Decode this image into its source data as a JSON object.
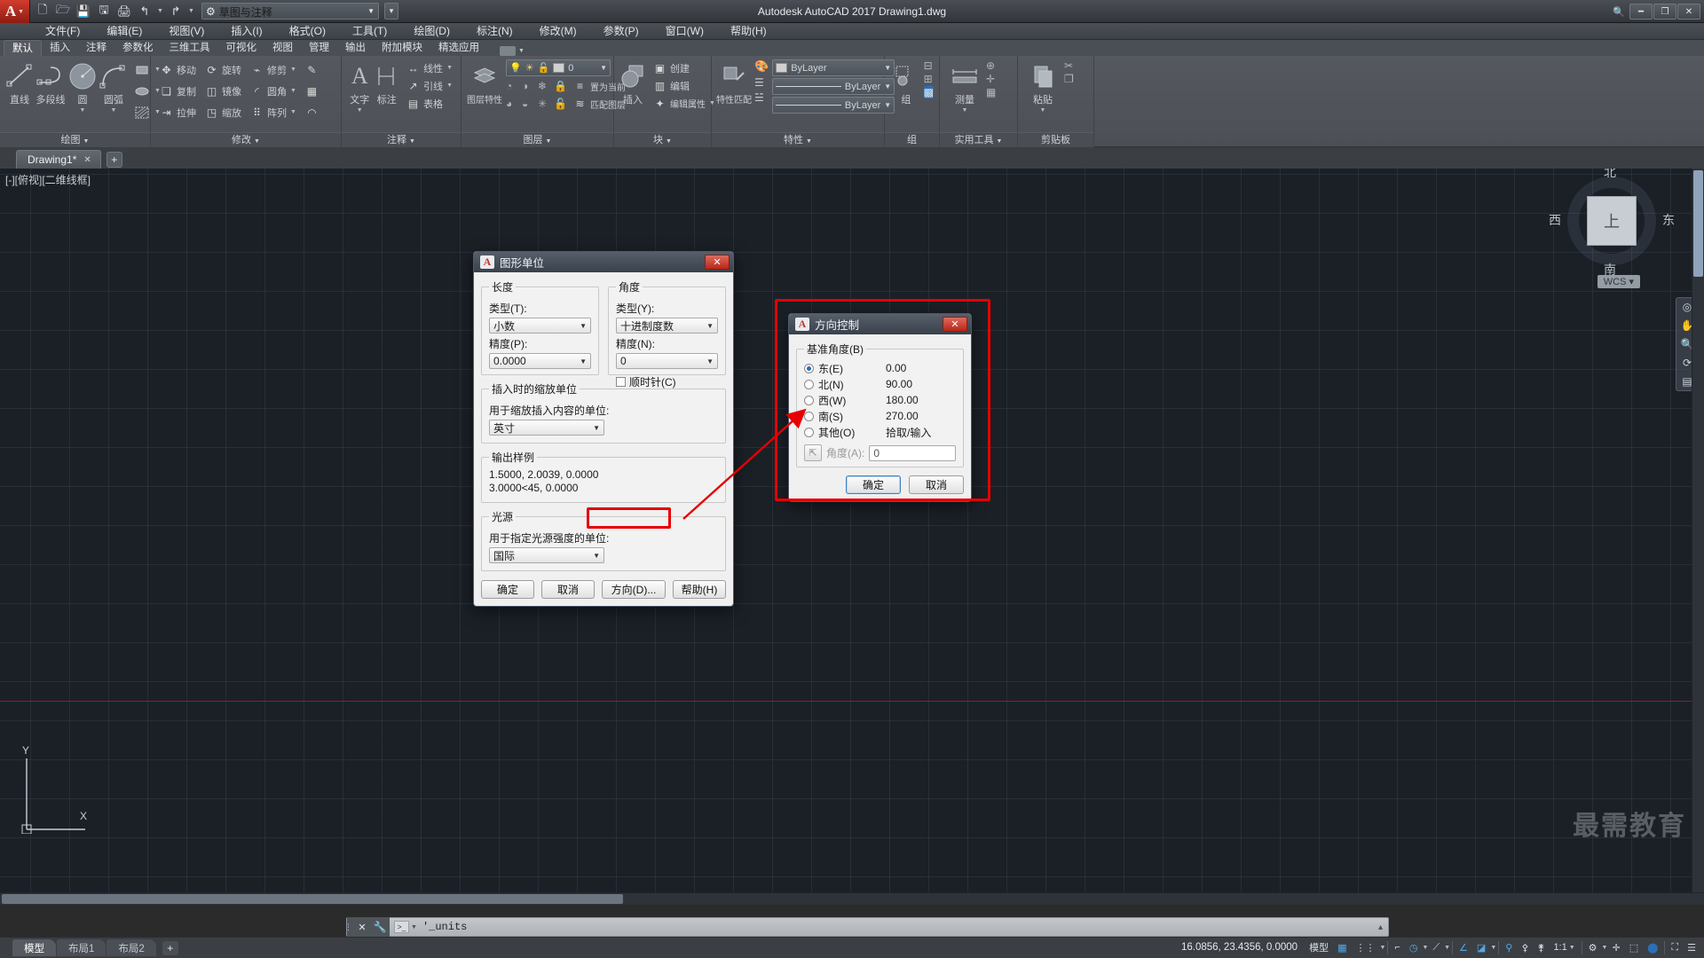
{
  "titlebar": {
    "app_icon": "autocad-a-logo",
    "quick_access": [
      "new-icon",
      "open-icon",
      "save-icon",
      "saveas-icon",
      "print-icon",
      "undo-icon",
      "redo-icon"
    ],
    "workspace": "草图与注释",
    "title": "Autodesk AutoCAD 2017   Drawing1.dwg",
    "window_buttons": [
      "minimize",
      "restore",
      "close"
    ]
  },
  "menubar": [
    "文件(F)",
    "编辑(E)",
    "视图(V)",
    "插入(I)",
    "格式(O)",
    "工具(T)",
    "绘图(D)",
    "标注(N)",
    "修改(M)",
    "参数(P)",
    "窗口(W)",
    "帮助(H)"
  ],
  "ribbon_tabs": [
    "默认",
    "插入",
    "注释",
    "参数化",
    "三维工具",
    "可视化",
    "视图",
    "管理",
    "输出",
    "附加模块",
    "精选应用"
  ],
  "ribbon_active_tab": "默认",
  "ribbon": {
    "panels": [
      {
        "name": "绘图",
        "big": [
          {
            "label": "直线",
            "icon": "line-icon"
          },
          {
            "label": "多段线",
            "icon": "polyline-icon"
          },
          {
            "label": "圆",
            "icon": "circle-icon",
            "caret": true
          },
          {
            "label": "圆弧",
            "icon": "arc-icon",
            "caret": true
          }
        ],
        "small": [
          {
            "label": "",
            "icon": "rectangle-icon",
            "caret": true
          },
          {
            "label": "",
            "icon": "ellipse-icon",
            "caret": true
          },
          {
            "label": "",
            "icon": "hatch-icon",
            "caret": true
          }
        ]
      },
      {
        "name": "修改",
        "small": [
          {
            "label": "移动",
            "icon": "move-icon"
          },
          {
            "label": "旋转",
            "icon": "rotate-icon"
          },
          {
            "label": "修剪",
            "icon": "trim-icon",
            "caret": true
          },
          {
            "label": "",
            "icon": "erase-icon"
          },
          {
            "label": "复制",
            "icon": "copy-icon"
          },
          {
            "label": "镜像",
            "icon": "mirror-icon"
          },
          {
            "label": "圆角",
            "icon": "fillet-icon",
            "caret": true
          },
          {
            "label": "",
            "icon": "array3d-icon"
          },
          {
            "label": "拉伸",
            "icon": "stretch-icon"
          },
          {
            "label": "缩放",
            "icon": "scale-icon"
          },
          {
            "label": "阵列",
            "icon": "array-icon",
            "caret": true
          },
          {
            "label": "",
            "icon": "offset-icon"
          }
        ]
      },
      {
        "name": "注释",
        "big": [
          {
            "label": "文字",
            "icon": "text-icon",
            "caret": true
          },
          {
            "label": "标注",
            "icon": "dimension-icon"
          }
        ],
        "small": [
          {
            "label": "线性",
            "icon": "linear-dim-icon",
            "caret": true
          },
          {
            "label": "引线",
            "icon": "leader-icon",
            "caret": true
          },
          {
            "label": "表格",
            "icon": "table-icon"
          }
        ]
      },
      {
        "name": "图层",
        "big": [
          {
            "label": "图层特性",
            "icon": "layer-properties-icon"
          }
        ],
        "layer_value": "0",
        "layer_icons": [
          "bulb-icon",
          "sun-icon",
          "unlock-icon"
        ],
        "small": [
          {
            "label": "置为当前",
            "icon": "set-current-layer-icon"
          },
          {
            "label": "匹配图层",
            "icon": "match-layer-icon"
          }
        ]
      },
      {
        "name": "块",
        "big": [
          {
            "label": "插入",
            "icon": "insert-block-icon"
          }
        ],
        "small": [
          {
            "label": "创建",
            "icon": "create-block-icon"
          },
          {
            "label": "编辑",
            "icon": "edit-block-icon"
          },
          {
            "label": "编辑属性",
            "icon": "edit-attribute-icon",
            "caret": true
          }
        ]
      },
      {
        "name": "特性",
        "big": [
          {
            "label": "特性匹配",
            "icon": "match-properties-icon"
          }
        ],
        "selects": [
          "ByLayer",
          "ByLayer",
          "ByLayer"
        ]
      },
      {
        "name": "组",
        "big": [
          {
            "label": "组",
            "icon": "group-icon"
          }
        ]
      },
      {
        "name": "实用工具",
        "big": [
          {
            "label": "测量",
            "icon": "measure-icon",
            "caret": true
          }
        ]
      },
      {
        "name": "剪贴板",
        "big": [
          {
            "label": "粘贴",
            "icon": "paste-icon",
            "caret": true
          }
        ]
      }
    ]
  },
  "file_tabs": [
    {
      "label": "Drawing1*",
      "active": true
    }
  ],
  "canvas": {
    "viewport_label": "[-][俯视][二维线框]",
    "viewcube": {
      "top": "北",
      "bottom": "南",
      "left": "西",
      "right": "东",
      "face": "上"
    },
    "ucs_indicator": "WCS",
    "axis_y": "Y",
    "axis_x": "X",
    "watermark": "最需教育"
  },
  "command_line": {
    "text": "'_units",
    "prompt_icon": "command-prompt-icon"
  },
  "layout_tabs": [
    "模型",
    "布局1",
    "布局2"
  ],
  "layout_active": "模型",
  "statusbar": {
    "coordinates": "16.0856, 23.4356, 0.0000",
    "model_label": "模型",
    "scale": "1:1",
    "items": [
      "grid-icon",
      "snap-icon",
      "ortho-icon",
      "polar-icon",
      "osnap-icon",
      "otrack-icon",
      "lineweight-icon",
      "transparency-icon",
      "selection-cycling-icon",
      "annotation-monitor-icon",
      "annotation-visibility-icon",
      "autoscale-icon",
      "workspace-icon",
      "customization-icon"
    ]
  },
  "units_dialog": {
    "title": "图形单位",
    "length": {
      "legend": "长度",
      "type_label": "类型(T):",
      "type_value": "小数",
      "precision_label": "精度(P):",
      "precision_value": "0.0000"
    },
    "angle": {
      "legend": "角度",
      "type_label": "类型(Y):",
      "type_value": "十进制度数",
      "precision_label": "精度(N):",
      "precision_value": "0",
      "clockwise_label": "顺时针(C)",
      "clockwise_checked": false
    },
    "insert_scale": {
      "legend": "插入时的缩放单位",
      "desc": "用于缩放插入内容的单位:",
      "value": "英寸"
    },
    "sample": {
      "legend": "输出样例",
      "line1": "1.5000, 2.0039, 0.0000",
      "line2": "3.0000<45, 0.0000"
    },
    "lighting": {
      "legend": "光源",
      "desc": "用于指定光源强度的单位:",
      "value": "国际"
    },
    "buttons": {
      "ok": "确定",
      "cancel": "取消",
      "direction": "方向(D)...",
      "help": "帮助(H)"
    }
  },
  "direction_dialog": {
    "title": "方向控制",
    "legend": "基准角度(B)",
    "options": [
      {
        "label": "东(E)",
        "value": "0.00",
        "selected": true
      },
      {
        "label": "北(N)",
        "value": "90.00",
        "selected": false
      },
      {
        "label": "西(W)",
        "value": "180.00",
        "selected": false
      },
      {
        "label": "南(S)",
        "value": "270.00",
        "selected": false
      },
      {
        "label": "其他(O)",
        "value": "拾取/输入",
        "selected": false
      }
    ],
    "angle_label": "角度(A):",
    "angle_value": "0",
    "pick_icon": "pick-point-icon",
    "buttons": {
      "ok": "确定",
      "cancel": "取消"
    }
  },
  "colors": {
    "accent_red": "#e60000",
    "canvas_bg": "#1b2027",
    "ribbon_bg": "#55595f",
    "dialog_bg": "#f0f0f0",
    "status_active": "#53a8e8"
  }
}
